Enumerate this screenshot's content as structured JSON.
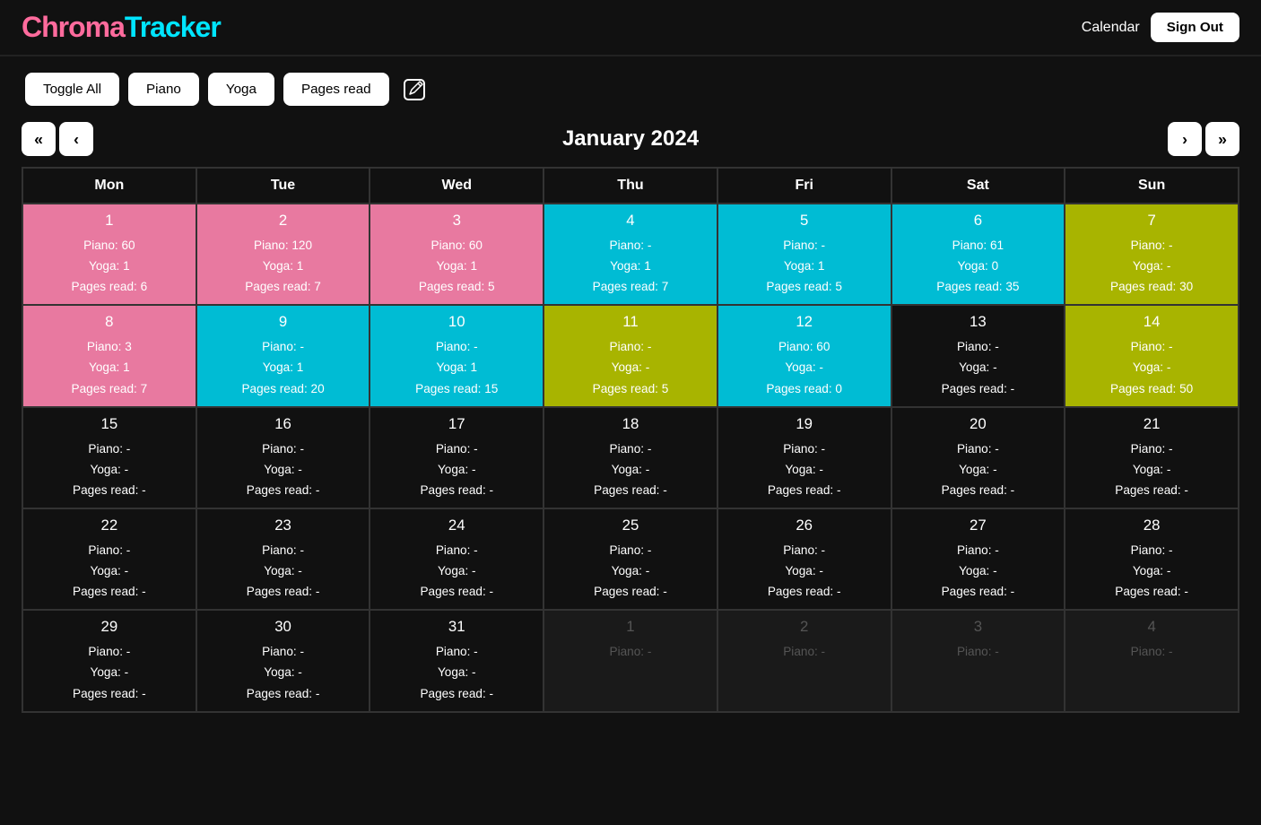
{
  "header": {
    "logo_chroma": "Chroma",
    "logo_tracker": "Tracker",
    "calendar_label": "Calendar",
    "sign_out_label": "Sign Out"
  },
  "toolbar": {
    "toggle_all_label": "Toggle All",
    "piano_label": "Piano",
    "yoga_label": "Yoga",
    "pages_read_label": "Pages read"
  },
  "calendar": {
    "title": "January 2024",
    "days_of_week": [
      "Mon",
      "Tue",
      "Wed",
      "Thu",
      "Fri",
      "Sat",
      "Sun"
    ],
    "nav": {
      "prev_prev": "«",
      "prev": "‹",
      "next": "›",
      "next_next": "»"
    },
    "weeks": [
      [
        {
          "date": 1,
          "color": "pink",
          "piano": "60",
          "yoga": "1",
          "pages_read": "6"
        },
        {
          "date": 2,
          "color": "pink",
          "piano": "120",
          "yoga": "1",
          "pages_read": "7"
        },
        {
          "date": 3,
          "color": "pink",
          "piano": "60",
          "yoga": "1",
          "pages_read": "5"
        },
        {
          "date": 4,
          "color": "cyan",
          "piano": "-",
          "yoga": "1",
          "pages_read": "7"
        },
        {
          "date": 5,
          "color": "cyan",
          "piano": "-",
          "yoga": "1",
          "pages_read": "5"
        },
        {
          "date": 6,
          "color": "cyan",
          "piano": "61",
          "yoga": "0",
          "pages_read": "35"
        },
        {
          "date": 7,
          "color": "olive",
          "piano": "-",
          "yoga": "-",
          "pages_read": "30"
        }
      ],
      [
        {
          "date": 8,
          "color": "pink",
          "piano": "3",
          "yoga": "1",
          "pages_read": "7"
        },
        {
          "date": 9,
          "color": "cyan",
          "piano": "-",
          "yoga": "1",
          "pages_read": "20"
        },
        {
          "date": 10,
          "color": "cyan",
          "piano": "-",
          "yoga": "1",
          "pages_read": "15"
        },
        {
          "date": 11,
          "color": "olive",
          "piano": "-",
          "yoga": "-",
          "pages_read": "5"
        },
        {
          "date": 12,
          "color": "cyan",
          "piano": "60",
          "yoga": "-",
          "pages_read": "0"
        },
        {
          "date": 13,
          "color": "",
          "piano": "-",
          "yoga": "-",
          "pages_read": "-"
        },
        {
          "date": 14,
          "color": "olive",
          "piano": "-",
          "yoga": "-",
          "pages_read": "50"
        }
      ],
      [
        {
          "date": 15,
          "color": "",
          "piano": "-",
          "yoga": "-",
          "pages_read": "-"
        },
        {
          "date": 16,
          "color": "",
          "piano": "-",
          "yoga": "-",
          "pages_read": "-"
        },
        {
          "date": 17,
          "color": "",
          "piano": "-",
          "yoga": "-",
          "pages_read": "-"
        },
        {
          "date": 18,
          "color": "",
          "piano": "-",
          "yoga": "-",
          "pages_read": "-"
        },
        {
          "date": 19,
          "color": "",
          "piano": "-",
          "yoga": "-",
          "pages_read": "-"
        },
        {
          "date": 20,
          "color": "",
          "piano": "-",
          "yoga": "-",
          "pages_read": "-"
        },
        {
          "date": 21,
          "color": "",
          "piano": "-",
          "yoga": "-",
          "pages_read": "-"
        }
      ],
      [
        {
          "date": 22,
          "color": "",
          "piano": "-",
          "yoga": "-",
          "pages_read": "-"
        },
        {
          "date": 23,
          "color": "",
          "piano": "-",
          "yoga": "-",
          "pages_read": "-"
        },
        {
          "date": 24,
          "color": "",
          "piano": "-",
          "yoga": "-",
          "pages_read": "-"
        },
        {
          "date": 25,
          "color": "",
          "piano": "-",
          "yoga": "-",
          "pages_read": "-"
        },
        {
          "date": 26,
          "color": "",
          "piano": "-",
          "yoga": "-",
          "pages_read": "-"
        },
        {
          "date": 27,
          "color": "",
          "piano": "-",
          "yoga": "-",
          "pages_read": "-"
        },
        {
          "date": 28,
          "color": "",
          "piano": "-",
          "yoga": "-",
          "pages_read": "-"
        }
      ],
      [
        {
          "date": 29,
          "color": "",
          "piano": "-",
          "yoga": "-",
          "pages_read": "-"
        },
        {
          "date": 30,
          "color": "",
          "piano": "-",
          "yoga": "-",
          "pages_read": "-"
        },
        {
          "date": 31,
          "color": "",
          "piano": "-",
          "yoga": "-",
          "pages_read": "-"
        },
        {
          "date": 1,
          "color": "",
          "piano": "-",
          "yoga": "-",
          "pages_read": "-",
          "other": true
        },
        {
          "date": 2,
          "color": "",
          "piano": "-",
          "yoga": "-",
          "pages_read": "-",
          "other": true
        },
        {
          "date": 3,
          "color": "",
          "piano": "-",
          "yoga": "-",
          "pages_read": "-",
          "other": true
        },
        {
          "date": 4,
          "color": "",
          "piano": "-",
          "yoga": "-",
          "pages_read": "-",
          "other": true
        }
      ]
    ]
  }
}
